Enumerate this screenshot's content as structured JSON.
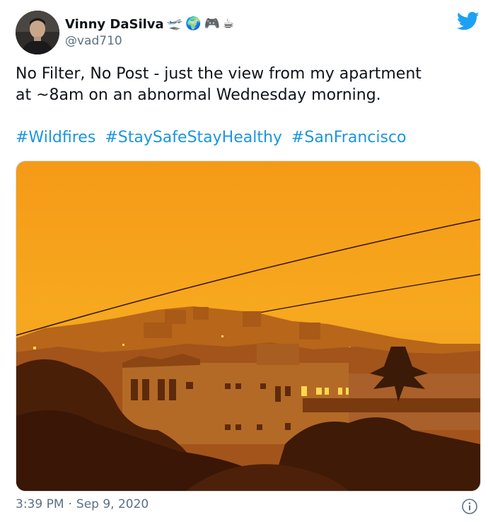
{
  "user": {
    "display_name": "Vinny DaSilva",
    "handle": "@vad710",
    "name_emojis": [
      "🛫",
      "🌍",
      "🎮",
      "☕"
    ]
  },
  "tweet": {
    "text": "No Filter, No Post - just the view from my apartment\nat ~8am on an abnormal Wednesday morning.",
    "hashtags": [
      "#Wildfires",
      "#StaySafeStayHealthy",
      "#SanFrancisco"
    ]
  },
  "footer": {
    "time": "3:39 PM",
    "separator": "·",
    "date": "Sep 9, 2020"
  },
  "icons": {
    "brand": "twitter-bird-icon",
    "info": "info-icon"
  },
  "colors": {
    "twitter_blue": "#1da1f2",
    "link_blue": "#1b95e0",
    "secondary_text": "#5b7083",
    "sky_orange": "#f7a21b"
  }
}
